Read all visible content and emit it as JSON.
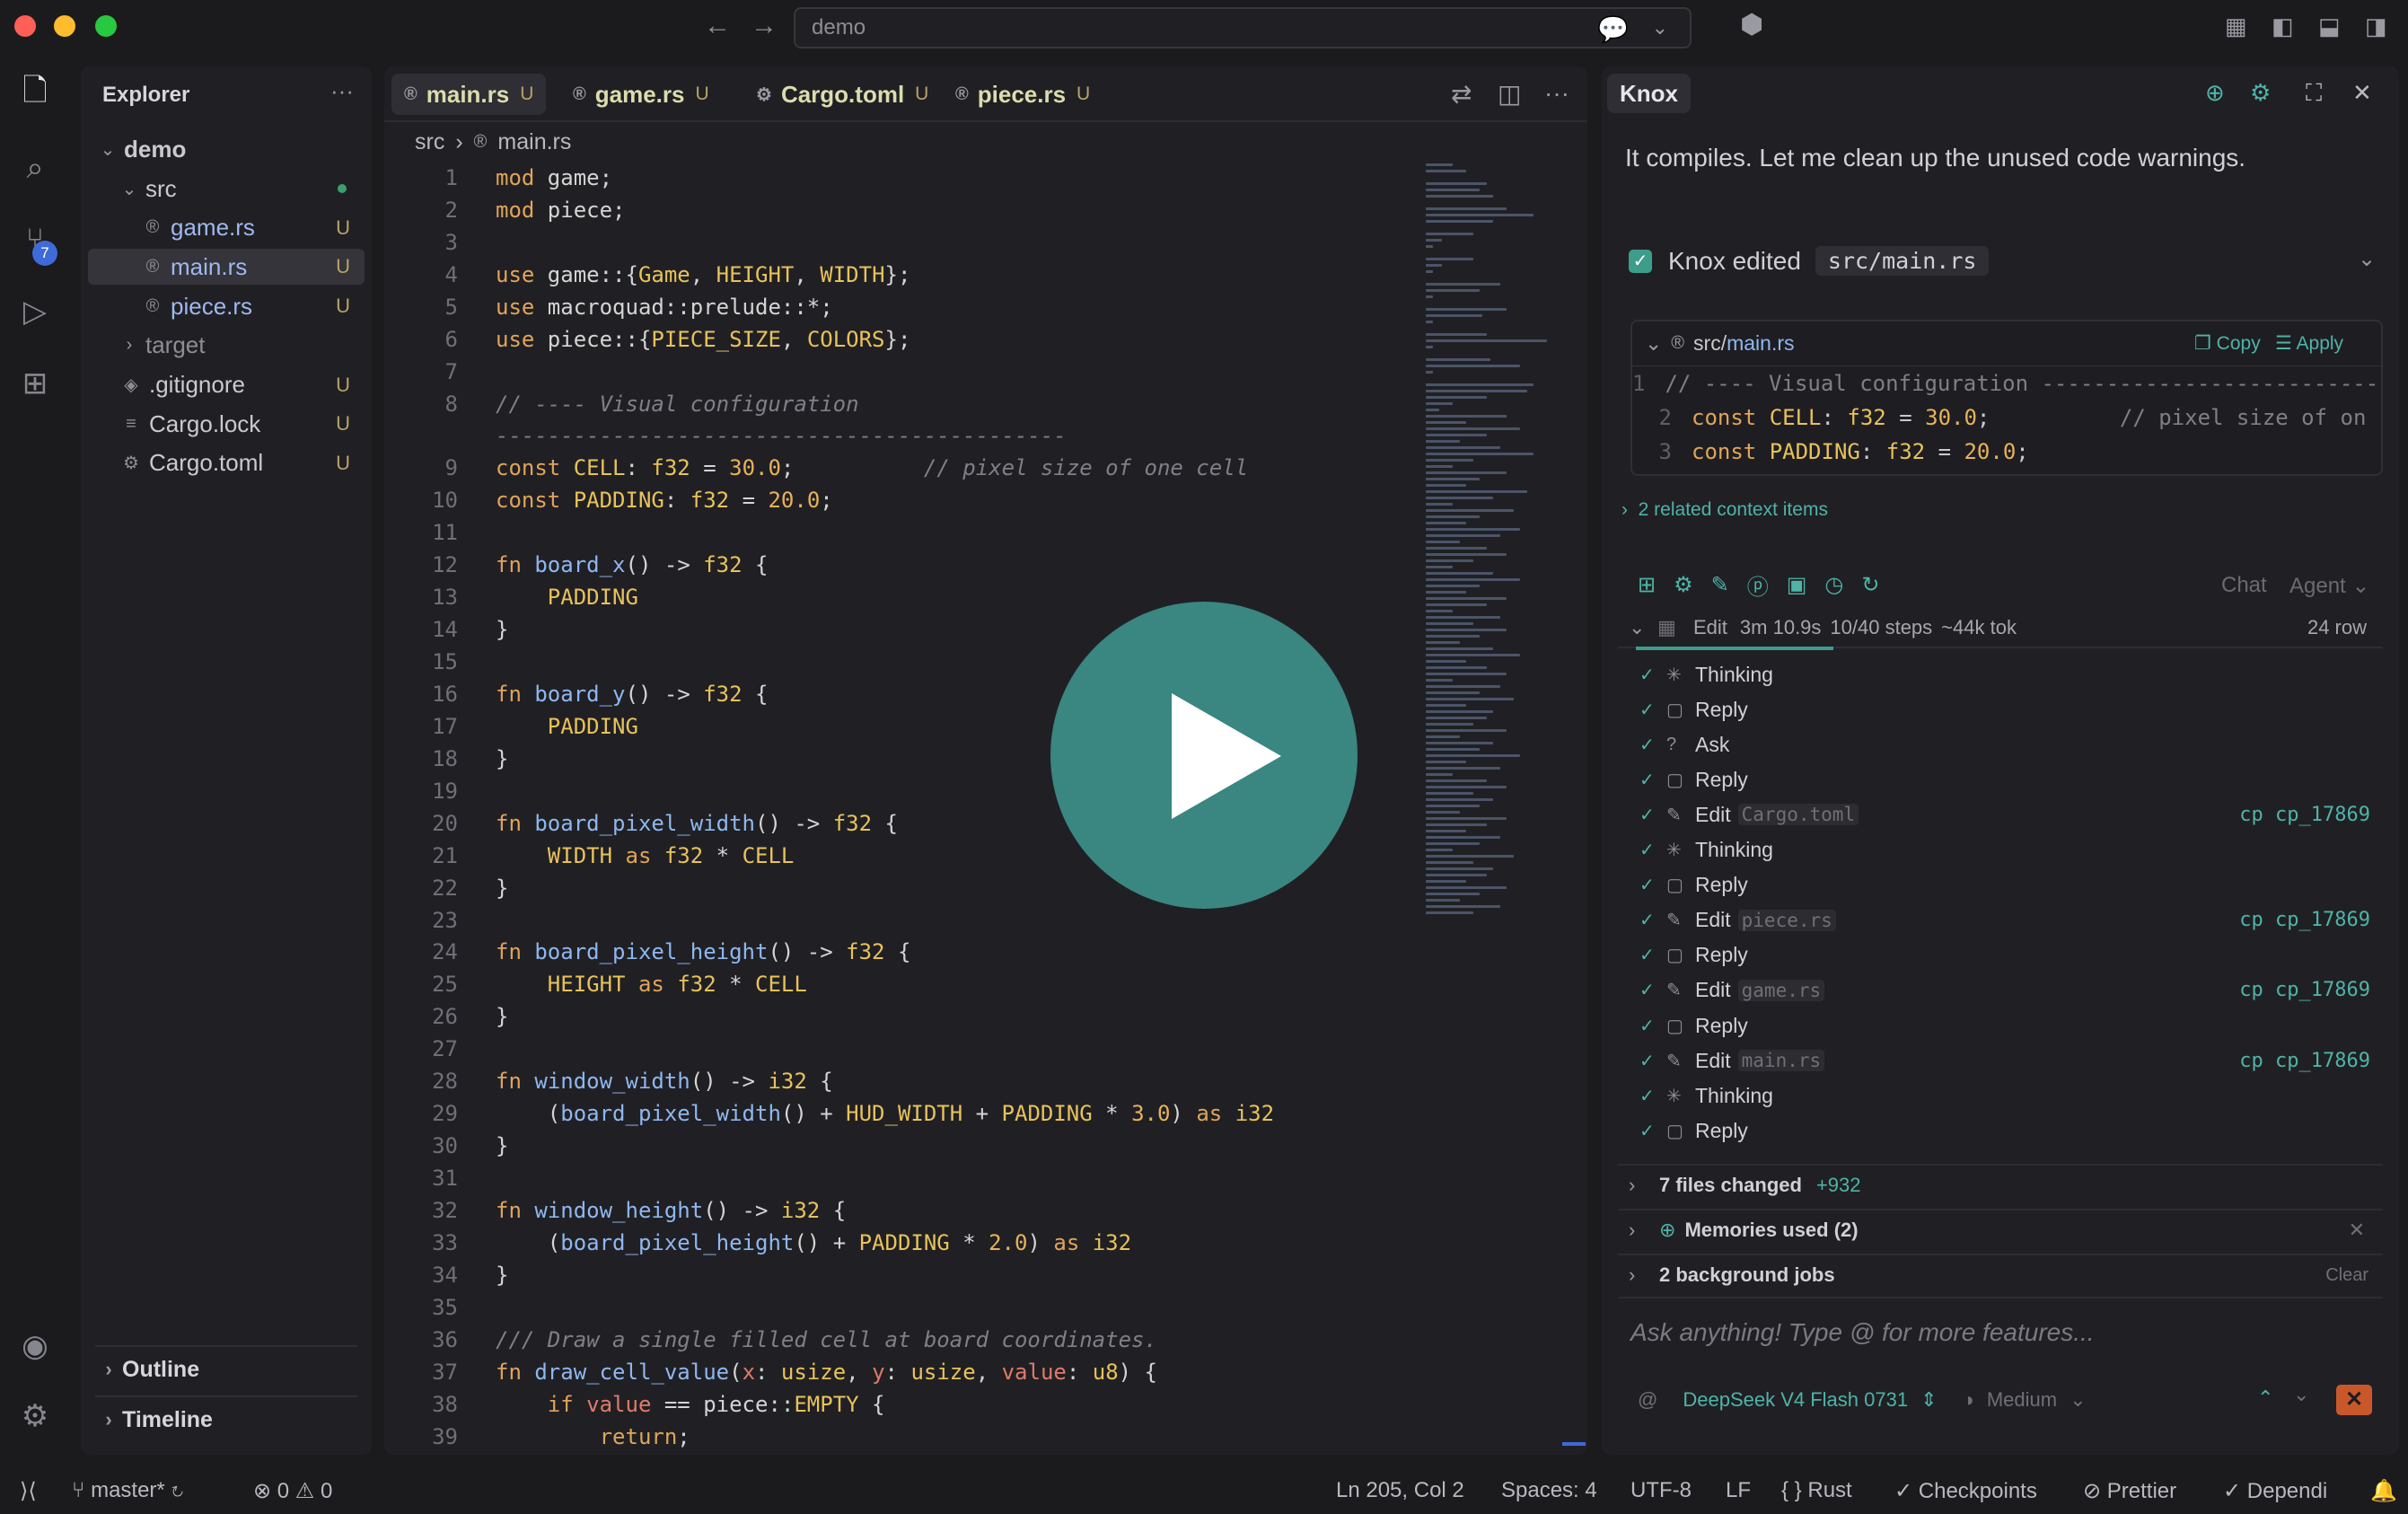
{
  "titlebar": {
    "search_text": "demo"
  },
  "activity": {
    "scm_badge": "7"
  },
  "explorer": {
    "title": "Explorer",
    "more": "···",
    "root": "demo",
    "items": [
      {
        "label": "src",
        "kind": "folder-open",
        "status": "",
        "indent": 1
      },
      {
        "label": "game.rs",
        "kind": "rust",
        "status": "U",
        "indent": 2
      },
      {
        "label": "main.rs",
        "kind": "rust",
        "status": "U",
        "indent": 2,
        "selected": true
      },
      {
        "label": "piece.rs",
        "kind": "rust",
        "status": "U",
        "indent": 2
      },
      {
        "label": "target",
        "kind": "folder",
        "status": "",
        "indent": 1
      },
      {
        "label": ".gitignore",
        "kind": "git",
        "status": "U",
        "indent": 1
      },
      {
        "label": "Cargo.lock",
        "kind": "lock",
        "status": "U",
        "indent": 1
      },
      {
        "label": "Cargo.toml",
        "kind": "gear",
        "status": "U",
        "indent": 1
      }
    ],
    "outline": "Outline",
    "timeline": "Timeline"
  },
  "editor": {
    "tabs": [
      {
        "label": "main.rs",
        "status": "U",
        "icon": "rust",
        "active": true
      },
      {
        "label": "game.rs",
        "status": "U",
        "icon": "rust"
      },
      {
        "label": "Cargo.toml",
        "status": "U",
        "icon": "gear"
      },
      {
        "label": "piece.rs",
        "status": "U",
        "icon": "rust"
      }
    ],
    "breadcrumb": [
      "src",
      "main.rs"
    ]
  },
  "agent": {
    "title": "Knox",
    "message": "It compiles. Let me clean up the unused code warnings.",
    "edit_label": "Knox edited",
    "edit_path": "src/main.rs",
    "snippet_dir": "src/",
    "snippet_file": "main.rs",
    "copy": "Copy",
    "apply": "Apply",
    "related": "2 related context items",
    "chat_label": "Chat",
    "agent_label": "Agent",
    "run": {
      "mode": "Edit",
      "time": "3m 10.9s",
      "steps": "10/40 steps",
      "tokens": "~44k tok",
      "rows": "24 row"
    },
    "steps": [
      {
        "label": "Thinking",
        "icon": "sparkle"
      },
      {
        "label": "Reply",
        "icon": "chat"
      },
      {
        "label": "Ask",
        "icon": "question"
      },
      {
        "label": "Reply",
        "icon": "chat"
      },
      {
        "label": "Edit",
        "icon": "edit",
        "file": "Cargo.toml",
        "cp": "cp cp_17869"
      },
      {
        "label": "Thinking",
        "icon": "sparkle"
      },
      {
        "label": "Reply",
        "icon": "chat"
      },
      {
        "label": "Edit",
        "icon": "edit",
        "file": "piece.rs",
        "cp": "cp cp_17869"
      },
      {
        "label": "Reply",
        "icon": "chat"
      },
      {
        "label": "Edit",
        "icon": "edit",
        "file": "game.rs",
        "cp": "cp cp_17869"
      },
      {
        "label": "Reply",
        "icon": "chat"
      },
      {
        "label": "Edit",
        "icon": "edit",
        "file": "main.rs",
        "cp": "cp cp_17869"
      },
      {
        "label": "Thinking",
        "icon": "sparkle"
      },
      {
        "label": "Reply",
        "icon": "chat"
      }
    ],
    "files_changed": "7 files changed",
    "files_delta": "+932",
    "memories": "Memories used (2)",
    "jobs": "2 background jobs",
    "jobs_clear": "Clear",
    "input_placeholder": "Ask anything! Type @ for more features...",
    "model": "DeepSeek V4 Flash 0731",
    "effort": "Medium"
  },
  "status": {
    "branch": "master*",
    "errors": "0",
    "warnings": "0",
    "position": "Ln 205, Col 2",
    "spaces": "Spaces: 4",
    "encoding": "UTF-8",
    "eol": "LF",
    "language": "Rust",
    "checkpoints": "Checkpoints",
    "prettier": "Prettier",
    "dependi": "Dependi"
  },
  "colors": {
    "accent": "#4fb3a8",
    "play_button": "#3d8f8a",
    "untracked": "#b8a26a"
  }
}
